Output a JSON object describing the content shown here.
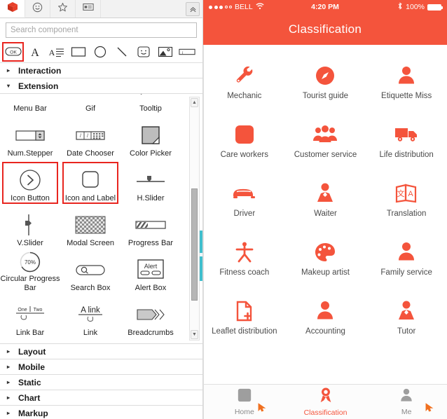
{
  "editor": {
    "tabs": [
      {
        "name": "components-tab",
        "icon": "red-box-icon",
        "active": true
      },
      {
        "name": "emoji-tab",
        "icon": "smiley-icon",
        "active": false
      },
      {
        "name": "favorites-tab",
        "icon": "star-icon",
        "active": false
      },
      {
        "name": "templates-tab",
        "icon": "card-icon",
        "active": false
      }
    ],
    "collapse_label": "«",
    "search": {
      "placeholder": "Search component",
      "value": ""
    },
    "toolbar": [
      {
        "name": "ok-button-tool",
        "label": "OK",
        "highlighted": true
      },
      {
        "name": "text-tool",
        "label": "A",
        "highlighted": false
      },
      {
        "name": "paragraph-tool",
        "label": "A≡",
        "highlighted": false
      },
      {
        "name": "rectangle-tool",
        "label": "",
        "highlighted": false
      },
      {
        "name": "ellipse-tool",
        "label": "",
        "highlighted": false
      },
      {
        "name": "line-tool",
        "label": "",
        "highlighted": false
      },
      {
        "name": "emoji-tool",
        "label": "",
        "highlighted": false
      },
      {
        "name": "image-tool",
        "label": "",
        "highlighted": false
      },
      {
        "name": "input-tool",
        "label": "",
        "highlighted": false
      }
    ],
    "sections": [
      {
        "label": "Interaction",
        "expanded": false
      },
      {
        "label": "Extension",
        "expanded": true
      },
      {
        "label": "Layout",
        "expanded": false
      },
      {
        "label": "Mobile",
        "expanded": false
      },
      {
        "label": "Static",
        "expanded": false
      },
      {
        "label": "Chart",
        "expanded": false
      },
      {
        "label": "Markup",
        "expanded": false
      }
    ],
    "extension_components": [
      {
        "label": "Menu Bar",
        "icon": "menu-bar-icon",
        "highlighted": false
      },
      {
        "label": "Gif",
        "icon": "gif-icon",
        "highlighted": false
      },
      {
        "label": "Tooltip",
        "icon": "tooltip-icon",
        "highlighted": false
      },
      {
        "label": "Num.Stepper",
        "icon": "num-stepper-icon",
        "highlighted": false
      },
      {
        "label": "Date Chooser",
        "icon": "date-chooser-icon",
        "highlighted": false
      },
      {
        "label": "Color Picker",
        "icon": "color-picker-icon",
        "highlighted": false
      },
      {
        "label": "Icon Button",
        "icon": "icon-button-icon",
        "highlighted": true
      },
      {
        "label": "Icon and Label",
        "icon": "icon-and-label-icon",
        "highlighted": true
      },
      {
        "label": "H.Slider",
        "icon": "h-slider-icon",
        "highlighted": false
      },
      {
        "label": "V.Slider",
        "icon": "v-slider-icon",
        "highlighted": false
      },
      {
        "label": "Modal Screen",
        "icon": "modal-screen-icon",
        "highlighted": false
      },
      {
        "label": "Progress Bar",
        "icon": "progress-bar-icon",
        "highlighted": false
      },
      {
        "label": "Circular Progress Bar",
        "icon": "circular-progress-icon",
        "icon_text": "70%",
        "highlighted": false
      },
      {
        "label": "Search Box",
        "icon": "search-box-icon",
        "highlighted": false
      },
      {
        "label": "Alert Box",
        "icon": "alert-box-icon",
        "icon_text": "Alert",
        "highlighted": false
      },
      {
        "label": "Link Bar",
        "icon": "link-bar-icon",
        "icon_text": "One | Two",
        "highlighted": false
      },
      {
        "label": "Link",
        "icon": "link-icon",
        "icon_text": "A link",
        "highlighted": false
      },
      {
        "label": "Breadcrumbs",
        "icon": "breadcrumbs-icon",
        "highlighted": false
      }
    ],
    "scrollbar": {
      "up_arrow": "▲",
      "down_arrow": "▼"
    }
  },
  "phone": {
    "status_bar": {
      "carrier": "BELL",
      "signal_dots_filled": 3,
      "signal_dots_empty": 2,
      "wifi_icon": "wifi-icon",
      "time": "4:20 PM",
      "bluetooth_icon": "bluetooth-icon",
      "battery_percent": "100%"
    },
    "nav_title": "Classification",
    "accent_color": "#f4543c",
    "grid": [
      {
        "label": "Mechanic",
        "icon": "wrench-icon"
      },
      {
        "label": "Tourist guide",
        "icon": "compass-icon"
      },
      {
        "label": "Etiquette Miss",
        "icon": "woman-icon"
      },
      {
        "label": "Care workers",
        "icon": "rounded-square-icon"
      },
      {
        "label": "Customer service",
        "icon": "people-group-icon"
      },
      {
        "label": "Life distribution",
        "icon": "truck-icon"
      },
      {
        "label": "Driver",
        "icon": "car-icon"
      },
      {
        "label": "Waiter",
        "icon": "suit-person-icon"
      },
      {
        "label": "Translation",
        "icon": "translate-card-icon"
      },
      {
        "label": "Fitness coach",
        "icon": "running-person-icon"
      },
      {
        "label": "Makeup artist",
        "icon": "palette-icon"
      },
      {
        "label": "Family service",
        "icon": "person-icon"
      },
      {
        "label": "Leaflet distribution",
        "icon": "document-plus-icon"
      },
      {
        "label": "Accounting",
        "icon": "person-icon"
      },
      {
        "label": "Tutor",
        "icon": "suit-person-icon"
      }
    ],
    "tab_bar": [
      {
        "label": "Home",
        "icon": "home-icon",
        "active": false
      },
      {
        "label": "Classification",
        "icon": "ribbon-icon",
        "active": true
      },
      {
        "label": "Me",
        "icon": "person-icon",
        "active": false
      }
    ]
  }
}
